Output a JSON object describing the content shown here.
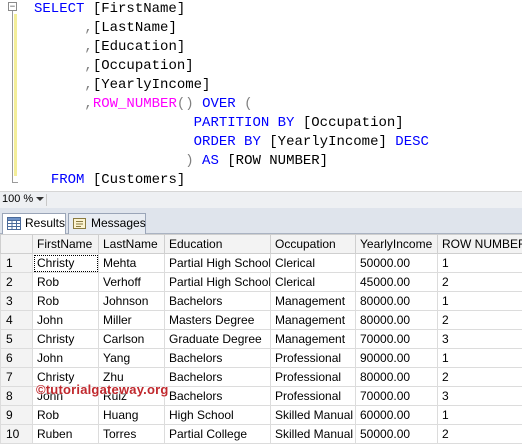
{
  "editor": {
    "fold_symbol": "⊟",
    "lines": [
      [
        {
          "t": "SELECT ",
          "c": "kw"
        },
        {
          "t": "[FirstName]",
          "c": "id"
        }
      ],
      [
        {
          "t": "      ",
          "c": "id"
        },
        {
          "t": ",",
          "c": "op"
        },
        {
          "t": "[LastName]",
          "c": "id"
        }
      ],
      [
        {
          "t": "      ",
          "c": "id"
        },
        {
          "t": ",",
          "c": "op"
        },
        {
          "t": "[Education]",
          "c": "id"
        }
      ],
      [
        {
          "t": "      ",
          "c": "id"
        },
        {
          "t": ",",
          "c": "op"
        },
        {
          "t": "[Occupation]",
          "c": "id"
        }
      ],
      [
        {
          "t": "      ",
          "c": "id"
        },
        {
          "t": ",",
          "c": "op"
        },
        {
          "t": "[YearlyIncome]",
          "c": "id"
        }
      ],
      [
        {
          "t": "      ",
          "c": "id"
        },
        {
          "t": ",",
          "c": "op"
        },
        {
          "t": "ROW_NUMBER",
          "c": "fn"
        },
        {
          "t": "() ",
          "c": "op"
        },
        {
          "t": "OVER ",
          "c": "kw"
        },
        {
          "t": "(",
          "c": "op"
        }
      ],
      [
        {
          "t": "                   ",
          "c": "id"
        },
        {
          "t": "PARTITION BY ",
          "c": "kw"
        },
        {
          "t": "[Occupation]",
          "c": "id"
        }
      ],
      [
        {
          "t": "                   ",
          "c": "id"
        },
        {
          "t": "ORDER BY ",
          "c": "kw"
        },
        {
          "t": "[YearlyIncome] ",
          "c": "id"
        },
        {
          "t": "DESC",
          "c": "kw"
        }
      ],
      [
        {
          "t": "                  ",
          "c": "id"
        },
        {
          "t": ") ",
          "c": "op"
        },
        {
          "t": "AS ",
          "c": "kw"
        },
        {
          "t": "[ROW NUMBER]",
          "c": "id"
        }
      ],
      [
        {
          "t": "  ",
          "c": "id"
        },
        {
          "t": "FROM ",
          "c": "kw"
        },
        {
          "t": "[Customers]",
          "c": "id"
        }
      ]
    ]
  },
  "zoom": {
    "value": "100 %"
  },
  "tabs": {
    "results_label": "Results",
    "messages_label": "Messages"
  },
  "results": {
    "columns": [
      "FirstName",
      "LastName",
      "Education",
      "Occupation",
      "YearlyIncome",
      "ROW NUMBER"
    ],
    "rows": [
      [
        "1",
        "Christy",
        "Mehta",
        "Partial High School",
        "Clerical",
        "50000.00",
        "1"
      ],
      [
        "2",
        "Rob",
        "Verhoff",
        "Partial High School",
        "Clerical",
        "45000.00",
        "2"
      ],
      [
        "3",
        "Rob",
        "Johnson",
        "Bachelors",
        "Management",
        "80000.00",
        "1"
      ],
      [
        "4",
        "John",
        "Miller",
        "Masters Degree",
        "Management",
        "80000.00",
        "2"
      ],
      [
        "5",
        "Christy",
        "Carlson",
        "Graduate Degree",
        "Management",
        "70000.00",
        "3"
      ],
      [
        "6",
        "John",
        "Yang",
        "Bachelors",
        "Professional",
        "90000.00",
        "1"
      ],
      [
        "7",
        "Christy",
        "Zhu",
        "Bachelors",
        "Professional",
        "80000.00",
        "2"
      ],
      [
        "8",
        "John",
        "Ruiz",
        "Bachelors",
        "Professional",
        "70000.00",
        "3"
      ],
      [
        "9",
        "Rob",
        "Huang",
        "High School",
        "Skilled Manual",
        "60000.00",
        "1"
      ],
      [
        "10",
        "Ruben",
        "Torres",
        "Partial College",
        "Skilled Manual",
        "50000.00",
        "2"
      ]
    ]
  },
  "watermark": "©tutorialgateway.org",
  "colors": {
    "keyword": "#0000ff",
    "function": "#ff00ff",
    "operator": "#808080",
    "watermark": "#c0282d"
  }
}
